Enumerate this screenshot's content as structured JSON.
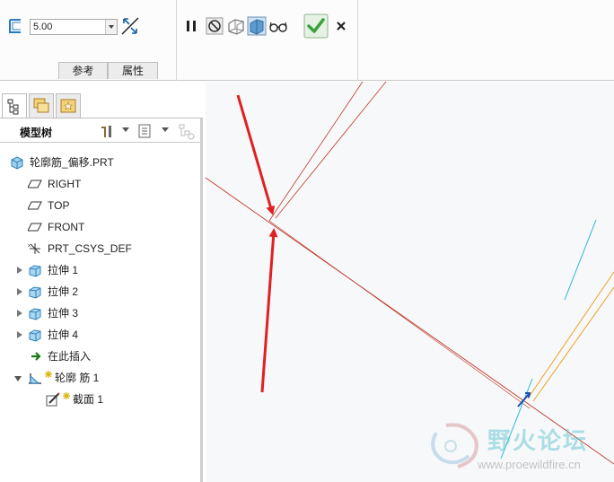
{
  "dashboard": {
    "thickness_value": "5.00",
    "tabs": {
      "references": "参考",
      "properties": "属性"
    }
  },
  "navigator": {
    "tree_header": "模型树",
    "items": [
      {
        "label": "轮廓筋_偏移.PRT"
      },
      {
        "label": "RIGHT"
      },
      {
        "label": "TOP"
      },
      {
        "label": "FRONT"
      },
      {
        "label": "PRT_CSYS_DEF"
      },
      {
        "label": "拉伸 1"
      },
      {
        "label": "拉伸 2"
      },
      {
        "label": "拉伸 3"
      },
      {
        "label": "拉伸 4"
      },
      {
        "label": "在此插入"
      },
      {
        "label": "轮廓 筋 1"
      },
      {
        "label": "截面 1"
      }
    ]
  },
  "watermark": {
    "text": "野火论坛",
    "url": "www.proewildfire.cn"
  },
  "colors": {
    "datum_red": "#c0392b",
    "annotation_red": "#e02020",
    "accent_cyan": "#2ab7d6",
    "accent_orange": "#f0a020",
    "ok_green": "#3aa33a"
  }
}
